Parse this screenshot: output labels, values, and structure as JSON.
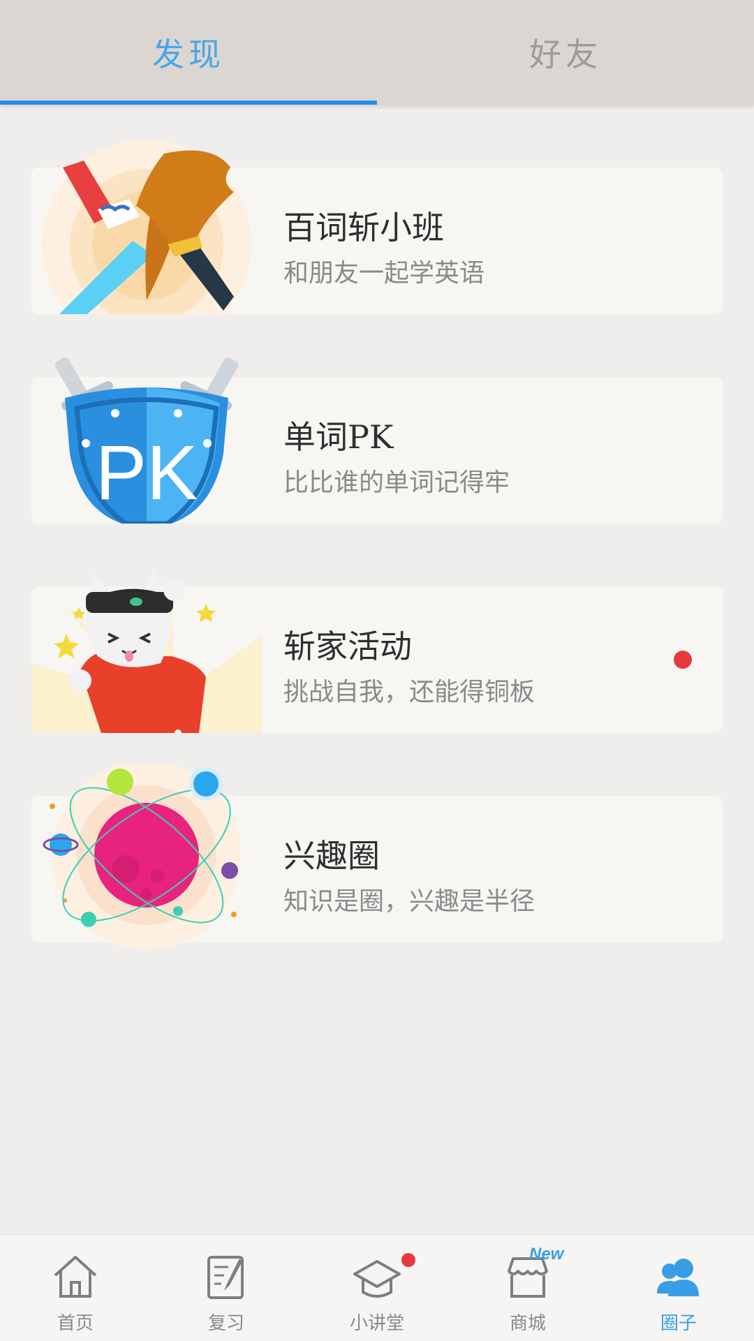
{
  "tabs": [
    {
      "label": "发现",
      "active": true
    },
    {
      "label": "好友",
      "active": false
    }
  ],
  "cards": [
    {
      "title": "百词斩小班",
      "subtitle": "和朋友一起学英语",
      "icon": "brush-sword-icon",
      "has_badge": false
    },
    {
      "title": "单词PK",
      "subtitle": "比比谁的单词记得牢",
      "icon": "pk-shield-icon",
      "has_badge": false
    },
    {
      "title": "斩家活动",
      "subtitle": "挑战自我，还能得铜板",
      "icon": "cat-mascot-icon",
      "has_badge": true
    },
    {
      "title": "兴趣圈",
      "subtitle": "知识是圈，兴趣是半径",
      "icon": "planet-icon",
      "has_badge": false
    }
  ],
  "pk_text": "PK",
  "bottom_nav": [
    {
      "label": "首页",
      "icon": "home-icon",
      "active": false
    },
    {
      "label": "复习",
      "icon": "review-icon",
      "active": false
    },
    {
      "label": "小讲堂",
      "icon": "graduation-cap-icon",
      "active": false,
      "badge": "dot"
    },
    {
      "label": "商城",
      "icon": "store-icon",
      "active": false,
      "badge": "New"
    },
    {
      "label": "圈子",
      "icon": "people-icon",
      "active": true
    }
  ],
  "colors": {
    "accent": "#3a9ee6",
    "badge_red": "#e6393d",
    "top_bar": "#dcd6d2",
    "background": "#efeeec"
  }
}
